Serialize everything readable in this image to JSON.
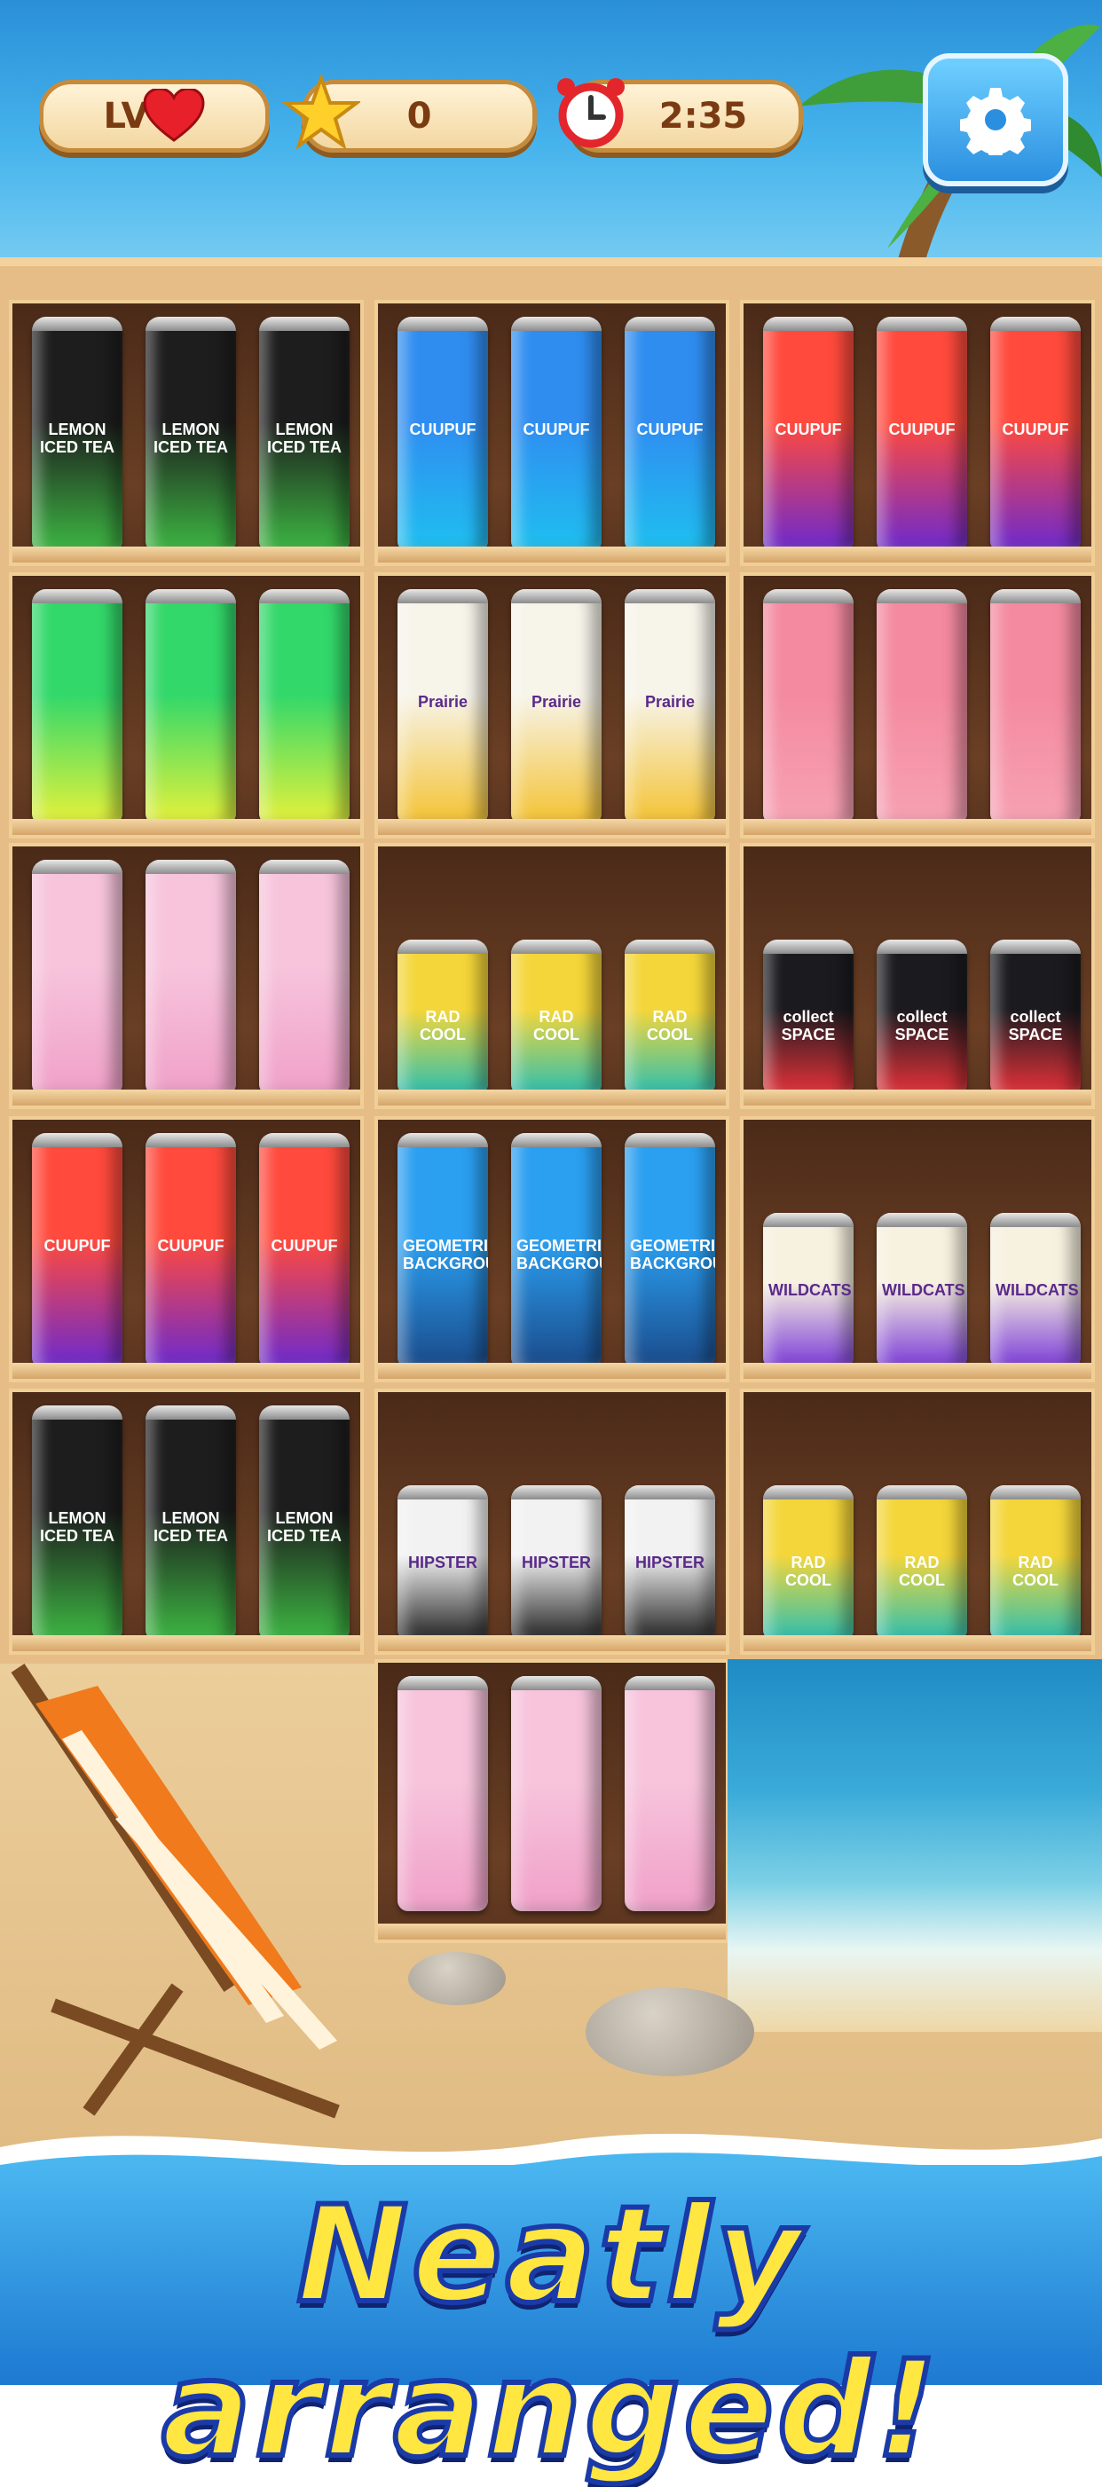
{
  "hud": {
    "level_label": "LV",
    "level_icon": "heart-icon",
    "stars_value": "0",
    "stars_icon": "star-icon",
    "timer_value": "2:35",
    "timer_icon": "alarm-clock-icon",
    "settings_icon": "gear-icon"
  },
  "shelves": [
    {
      "row": 1,
      "cells": [
        {
          "brand": "LEMON ICED TEA",
          "color": "#1d1d1d",
          "accent": "#3db843"
        },
        {
          "brand": "CUUPUF",
          "color": "#2f8df0",
          "accent": "#1fc0f0"
        },
        {
          "brand": "CUUPUF",
          "color": "#ff4a3d",
          "accent": "#6a2ad0"
        }
      ]
    },
    {
      "row": 2,
      "cells": [
        {
          "brand": "",
          "color": "#33d86a",
          "accent": "#e8f23a"
        },
        {
          "brand": "Prairie",
          "color": "#f7f4ea",
          "accent": "#f4c231"
        },
        {
          "brand": "",
          "color": "#f48aa0",
          "accent": "#f7a2b4"
        }
      ]
    },
    {
      "row": 3,
      "cells": [
        {
          "brand": "",
          "color": "#f7c4dc",
          "accent": "#f0a0c8"
        },
        {
          "brand": "RAD COOL",
          "color": "#f4d63a",
          "accent": "#2bbfb0"
        },
        {
          "brand": "collect SPACE",
          "color": "#1b1b1f",
          "accent": "#e8323a"
        }
      ]
    },
    {
      "row": 4,
      "cells": [
        {
          "brand": "CUUPUF",
          "color": "#ff4a3d",
          "accent": "#6a2ad0"
        },
        {
          "brand": "GEOMETRIC BACKGROUND",
          "color": "#2b9ff0",
          "accent": "#1a4a8a"
        },
        {
          "brand": "WILDCATS",
          "color": "#f7f1df",
          "accent": "#7a3ad8"
        }
      ]
    },
    {
      "row": 5,
      "cells": [
        {
          "brand": "LEMON ICED TEA",
          "color": "#1d1d1d",
          "accent": "#3db843"
        },
        {
          "brand": "HIPSTER",
          "color": "#f2f2f2",
          "accent": "#222222"
        },
        {
          "brand": "RAD COOL",
          "color": "#f4d63a",
          "accent": "#2bbfb0"
        }
      ]
    },
    {
      "row": 6,
      "cells": [
        {
          "brand": "",
          "color": "",
          "accent": ""
        },
        {
          "brand": "",
          "color": "#f7c4dc",
          "accent": "#f0a0c8"
        },
        {
          "brand": "",
          "color": "",
          "accent": ""
        }
      ]
    }
  ],
  "banner": {
    "text": "Neatly arranged!"
  }
}
